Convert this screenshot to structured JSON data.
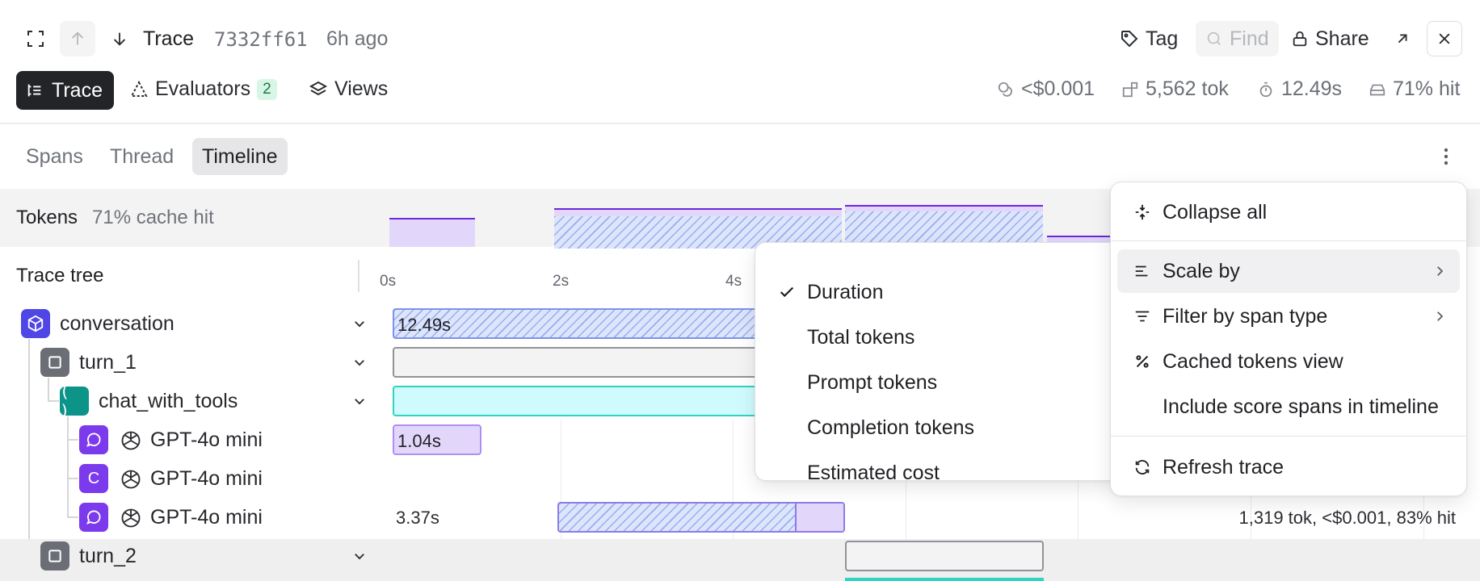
{
  "header": {
    "title": "Trace",
    "trace_id": "7332ff61",
    "age": "6h ago",
    "tag_label": "Tag",
    "find_label": "Find",
    "share_label": "Share"
  },
  "tabs": {
    "trace_label": "Trace",
    "evaluators_label": "Evaluators",
    "evaluators_count": "2",
    "views_label": "Views"
  },
  "stats": {
    "cost": "<$0.001",
    "tokens": "5,562 tok",
    "duration": "12.49s",
    "cache": "71% hit"
  },
  "view_tabs": [
    "Spans",
    "Thread",
    "Timeline"
  ],
  "tokens_band": {
    "label": "Tokens",
    "cache_hit": "71% cache hit"
  },
  "timeline": {
    "tree_header": "Trace tree",
    "ticks": [
      "0s",
      "2s",
      "4s"
    ],
    "rows": [
      {
        "name": "conversation",
        "bar_label": "12.49s"
      },
      {
        "name": "turn_1"
      },
      {
        "name": "chat_with_tools"
      },
      {
        "name": "GPT-4o mini",
        "bar_label": "1.04s"
      },
      {
        "name": "GPT-4o mini"
      },
      {
        "name": "GPT-4o mini",
        "bar_label": "3.37s",
        "meta": "1,319 tok, <$0.001, 83% hit"
      },
      {
        "name": "turn_2"
      }
    ]
  },
  "context_menu": {
    "items": [
      {
        "label": "Collapse all",
        "icon": "collapse-icon"
      },
      {
        "label": "Scale by",
        "icon": "scale-icon"
      },
      {
        "label": "Filter by span type",
        "icon": "filter-icon"
      },
      {
        "label": "Cached tokens view",
        "icon": "percent-icon"
      },
      {
        "label": "Include score spans in timeline"
      },
      {
        "label": "Refresh trace",
        "icon": "refresh-icon"
      }
    ]
  },
  "scale_submenu": {
    "selected": "Duration",
    "items": [
      "Duration",
      "Total tokens",
      "Prompt tokens",
      "Completion tokens",
      "Estimated cost"
    ]
  },
  "colors": {
    "llm_purple": "#7c3aed",
    "task_blue": "#4f46e5",
    "tool_teal": "#0d9488",
    "tool_bar": "#cffafe",
    "llm_bar": "#e2d7fb"
  }
}
